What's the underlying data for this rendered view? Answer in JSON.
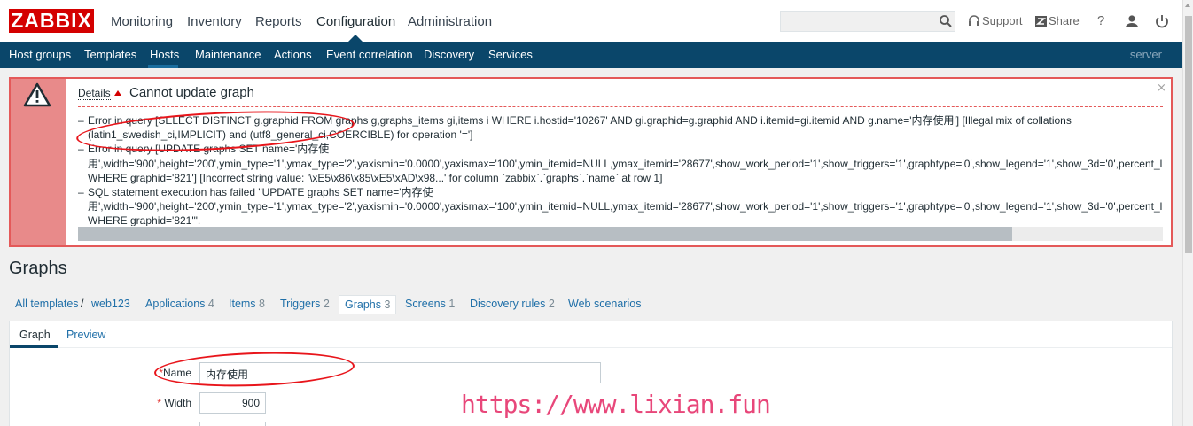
{
  "header": {
    "logo": "ZABBIX",
    "menu": [
      "Monitoring",
      "Inventory",
      "Reports",
      "Configuration",
      "Administration"
    ],
    "active_menu": "Configuration",
    "search_value": "",
    "support_label": "Support",
    "share_label": "Share",
    "help_label": "?"
  },
  "subnav": {
    "items": [
      "Host groups",
      "Templates",
      "Hosts",
      "Maintenance",
      "Actions",
      "Event correlation",
      "Discovery",
      "Services"
    ],
    "active": "Hosts",
    "server": "server"
  },
  "error": {
    "details_label": "Details",
    "title": "Cannot update graph",
    "close": "×",
    "items": [
      {
        "lines": [
          "Error in query [SELECT DISTINCT g.graphid FROM graphs g,graphs_items gi,items i WHERE i.hostid='10267' AND gi.graphid=g.graphid AND i.itemid=gi.itemid AND g.name='内存使用'] [Illegal mix of collations",
          "(latin1_swedish_ci,IMPLICIT) and (utf8_general_ci,COERCIBLE) for operation '=']"
        ]
      },
      {
        "lines": [
          "Error in query [UPDATE graphs SET name='内存使",
          "用',width='900',height='200',ymin_type='1',ymax_type='2',yaxismin='0.0000',yaxismax='100',ymin_itemid=NULL,ymax_itemid='28677',show_work_period='1',show_triggers='1',graphtype='0',show_legend='1',show_3d='0',percent_l",
          "WHERE graphid='821'] [Incorrect string value: '\\xE5\\x86\\x85\\xE5\\xAD\\x98...' for column `zabbix`.`graphs`.`name` at row 1]"
        ]
      },
      {
        "lines": [
          "SQL statement execution has failed \"UPDATE graphs SET name='内存使",
          "用',width='900',height='200',ymin_type='1',ymax_type='2',yaxismin='0.0000',yaxismax='100',ymin_itemid=NULL,ymax_itemid='28677',show_work_period='1',show_triggers='1',graphtype='0',show_legend='1',show_3d='0',percent_l",
          "WHERE graphid='821'\"."
        ]
      }
    ],
    "dash": "–"
  },
  "page": {
    "title": "Graphs"
  },
  "breadcrumbs": {
    "all_templates": "All templates",
    "separator": "/",
    "template": "web123",
    "links": [
      {
        "label": "Applications",
        "count": "4"
      },
      {
        "label": "Items",
        "count": "8"
      },
      {
        "label": "Triggers",
        "count": "2"
      },
      {
        "label": "Graphs",
        "count": "3"
      },
      {
        "label": "Screens",
        "count": "1"
      },
      {
        "label": "Discovery rules",
        "count": "2"
      },
      {
        "label": "Web scenarios",
        "count": ""
      }
    ]
  },
  "form": {
    "tabs": [
      "Graph",
      "Preview"
    ],
    "active_tab": "Graph",
    "required_mark": "*",
    "name_label": "Name",
    "name_value": "内存使用",
    "width_label": "Width",
    "width_value": "900"
  },
  "watermark": "https://www.lixian.fun",
  "colors": {
    "brand": "#d40000",
    "nav": "#0a466a",
    "error_border": "#e45959",
    "link": "#1f6fa8",
    "annotation": "#e8151b",
    "watermark": "#e8477a"
  }
}
